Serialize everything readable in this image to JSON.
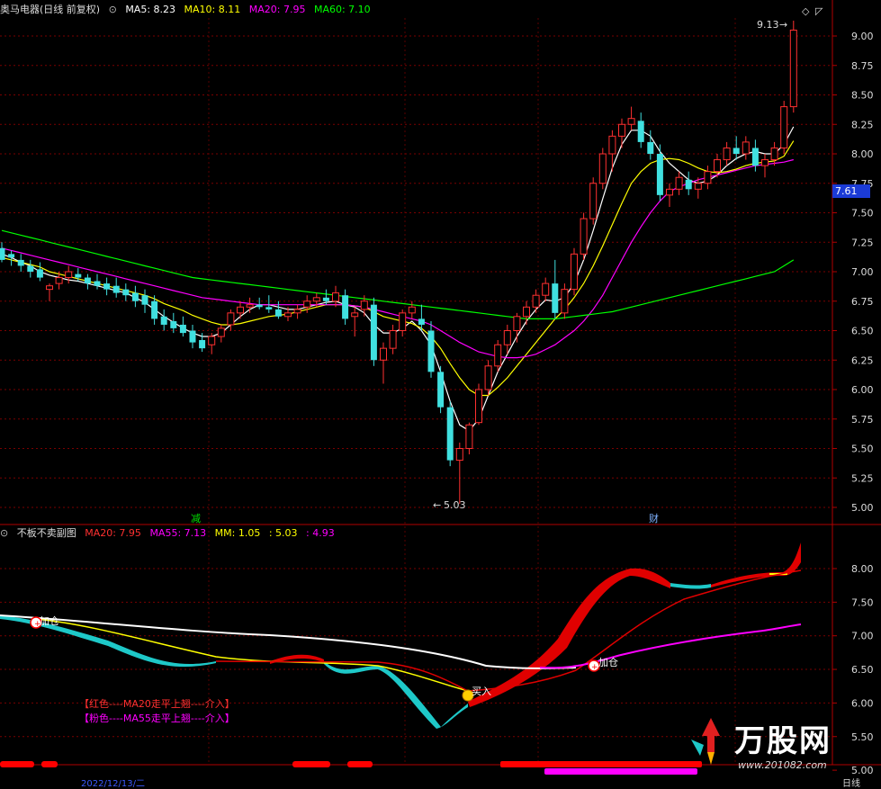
{
  "header_main": {
    "title": "奥马电器(日线 前复权)",
    "ma5": "MA5: 8.23",
    "ma10": "MA10: 8.11",
    "ma20": "MA20: 7.95",
    "ma60": "MA60: 7.10",
    "colors": {
      "title": "#dcdcdc",
      "ma5": "#ffffff",
      "ma10": "#ffff00",
      "ma20": "#ff00ff",
      "ma60": "#00ff00"
    }
  },
  "header_sub": {
    "title": "不板不卖副图",
    "ma20": "MA20: 7.95",
    "ma55": "MA55: 7.13",
    "mm": "MM: 1.05",
    "v1": ": 5.03",
    "v2": ": 4.93"
  },
  "main_axis": {
    "ticks": [
      "9.00",
      "8.75",
      "8.50",
      "8.25",
      "8.00",
      "7.75",
      "7.50",
      "7.25",
      "7.00",
      "6.75",
      "6.50",
      "6.25",
      "6.00",
      "5.75",
      "5.50",
      "5.25",
      "5.00"
    ],
    "current_price": "7.61",
    "high_label": "9.13",
    "low_label": "5.03"
  },
  "sub_axis": {
    "ticks": [
      "8.00",
      "7.50",
      "7.00",
      "6.50",
      "6.00",
      "5.50",
      "5.00"
    ]
  },
  "markers": {
    "reduce": "减",
    "finance": "财",
    "add_left": "加仓",
    "add_right": "加仓",
    "buy": "买入"
  },
  "notes": {
    "line1": "【红色----MA20走平上翘----介入】",
    "line2": "【粉色----MA55走平上翘----介入】"
  },
  "bottom": {
    "date": "2022/12/13/二",
    "right": "日线"
  },
  "brand": {
    "name": "万股网",
    "site": "www.201082.com"
  },
  "icons": {
    "collapse": "circle-chevron-icon",
    "diamond": "diamond-icon"
  },
  "chart_data": {
    "type": "candlestick",
    "title": "奥马电器(日线 前复权)",
    "ylim": [
      4.9,
      9.25
    ],
    "ohlc": [
      [
        7.2,
        7.25,
        7.08,
        7.1
      ],
      [
        7.15,
        7.18,
        7.05,
        7.12
      ],
      [
        7.1,
        7.15,
        7.0,
        7.05
      ],
      [
        7.05,
        7.1,
        6.95,
        7.0
      ],
      [
        7.02,
        7.08,
        6.92,
        6.95
      ],
      [
        6.85,
        6.9,
        6.75,
        6.88
      ],
      [
        6.9,
        7.0,
        6.85,
        6.95
      ],
      [
        6.95,
        7.05,
        6.9,
        7.0
      ],
      [
        6.98,
        7.03,
        6.92,
        6.95
      ],
      [
        6.95,
        6.98,
        6.85,
        6.9
      ],
      [
        6.92,
        6.98,
        6.85,
        6.88
      ],
      [
        6.9,
        6.95,
        6.8,
        6.85
      ],
      [
        6.88,
        6.95,
        6.78,
        6.82
      ],
      [
        6.85,
        6.9,
        6.75,
        6.8
      ],
      [
        6.82,
        6.88,
        6.7,
        6.75
      ],
      [
        6.8,
        6.85,
        6.65,
        6.72
      ],
      [
        6.75,
        6.8,
        6.55,
        6.6
      ],
      [
        6.62,
        6.68,
        6.5,
        6.55
      ],
      [
        6.58,
        6.65,
        6.48,
        6.52
      ],
      [
        6.55,
        6.62,
        6.45,
        6.48
      ],
      [
        6.5,
        6.55,
        6.35,
        6.4
      ],
      [
        6.42,
        6.48,
        6.32,
        6.35
      ],
      [
        6.38,
        6.48,
        6.3,
        6.45
      ],
      [
        6.45,
        6.55,
        6.4,
        6.52
      ],
      [
        6.55,
        6.68,
        6.5,
        6.65
      ],
      [
        6.65,
        6.75,
        6.6,
        6.7
      ],
      [
        6.7,
        6.78,
        6.65,
        6.72
      ],
      [
        6.72,
        6.78,
        6.68,
        6.7
      ],
      [
        6.7,
        6.8,
        6.65,
        6.68
      ],
      [
        6.68,
        6.75,
        6.6,
        6.62
      ],
      [
        6.62,
        6.7,
        6.58,
        6.65
      ],
      [
        6.65,
        6.72,
        6.6,
        6.68
      ],
      [
        6.7,
        6.8,
        6.65,
        6.75
      ],
      [
        6.75,
        6.82,
        6.7,
        6.78
      ],
      [
        6.78,
        6.85,
        6.72,
        6.75
      ],
      [
        6.75,
        6.88,
        6.7,
        6.82
      ],
      [
        6.8,
        6.85,
        6.55,
        6.6
      ],
      [
        6.62,
        6.7,
        6.45,
        6.65
      ],
      [
        6.68,
        6.8,
        6.62,
        6.75
      ],
      [
        6.72,
        6.78,
        6.2,
        6.25
      ],
      [
        6.25,
        6.4,
        6.05,
        6.35
      ],
      [
        6.35,
        6.55,
        6.3,
        6.5
      ],
      [
        6.5,
        6.68,
        6.45,
        6.65
      ],
      [
        6.65,
        6.75,
        6.6,
        6.7
      ],
      [
        6.6,
        6.72,
        6.5,
        6.55
      ],
      [
        6.5,
        6.58,
        6.1,
        6.15
      ],
      [
        6.15,
        6.2,
        5.8,
        5.85
      ],
      [
        5.85,
        5.9,
        5.35,
        5.4
      ],
      [
        5.4,
        5.55,
        5.03,
        5.5
      ],
      [
        5.5,
        5.72,
        5.45,
        5.7
      ],
      [
        5.72,
        6.05,
        5.7,
        6.0
      ],
      [
        6.0,
        6.25,
        5.95,
        6.2
      ],
      [
        6.2,
        6.42,
        6.15,
        6.38
      ],
      [
        6.38,
        6.55,
        6.3,
        6.5
      ],
      [
        6.5,
        6.65,
        6.4,
        6.62
      ],
      [
        6.62,
        6.75,
        6.55,
        6.7
      ],
      [
        6.7,
        6.85,
        6.65,
        6.8
      ],
      [
        6.8,
        6.95,
        6.75,
        6.9
      ],
      [
        6.9,
        7.1,
        6.6,
        6.65
      ],
      [
        6.65,
        6.9,
        6.6,
        6.85
      ],
      [
        6.85,
        7.2,
        6.8,
        7.15
      ],
      [
        7.15,
        7.5,
        7.1,
        7.45
      ],
      [
        7.45,
        7.8,
        7.4,
        7.75
      ],
      [
        7.75,
        8.05,
        7.7,
        8.0
      ],
      [
        8.0,
        8.2,
        7.85,
        8.15
      ],
      [
        8.15,
        8.3,
        8.05,
        8.25
      ],
      [
        8.25,
        8.4,
        8.2,
        8.3
      ],
      [
        8.28,
        8.35,
        8.05,
        8.1
      ],
      [
        8.1,
        8.2,
        7.95,
        8.0
      ],
      [
        8.0,
        8.08,
        7.6,
        7.65
      ],
      [
        7.65,
        7.75,
        7.55,
        7.7
      ],
      [
        7.7,
        7.85,
        7.65,
        7.8
      ],
      [
        7.78,
        7.85,
        7.65,
        7.7
      ],
      [
        7.7,
        7.8,
        7.62,
        7.75
      ],
      [
        7.75,
        7.9,
        7.7,
        7.85
      ],
      [
        7.85,
        8.0,
        7.8,
        7.95
      ],
      [
        7.95,
        8.1,
        7.9,
        8.05
      ],
      [
        8.05,
        8.15,
        7.95,
        8.0
      ],
      [
        8.0,
        8.15,
        7.95,
        8.1
      ],
      [
        8.05,
        8.12,
        7.85,
        7.9
      ],
      [
        7.9,
        8.0,
        7.8,
        7.95
      ],
      [
        7.95,
        8.1,
        7.9,
        8.05
      ],
      [
        8.05,
        8.45,
        8.0,
        8.4
      ],
      [
        8.4,
        9.13,
        8.35,
        9.05
      ]
    ],
    "series": [
      {
        "name": "MA5",
        "color": "#ffffff",
        "values": [
          7.15,
          7.12,
          7.08,
          7.05,
          7.0,
          6.97,
          6.95,
          6.93,
          6.92,
          6.9,
          6.88,
          6.86,
          6.84,
          6.82,
          6.78,
          6.74,
          6.68,
          6.62,
          6.57,
          6.52,
          6.48,
          6.45,
          6.45,
          6.48,
          6.55,
          6.62,
          6.68,
          6.72,
          6.72,
          6.7,
          6.68,
          6.68,
          6.7,
          6.72,
          6.74,
          6.75,
          6.72,
          6.7,
          6.65,
          6.55,
          6.48,
          6.48,
          6.52,
          6.58,
          6.5,
          6.38,
          6.15,
          5.9,
          5.7,
          5.65,
          5.75,
          5.95,
          6.15,
          6.3,
          6.45,
          6.58,
          6.68,
          6.76,
          6.75,
          6.78,
          6.9,
          7.1,
          7.35,
          7.62,
          7.88,
          8.08,
          8.2,
          8.2,
          8.15,
          8.02,
          7.92,
          7.85,
          7.78,
          7.75,
          7.77,
          7.82,
          7.9,
          7.96,
          8.0,
          8.02,
          8.0,
          8.0,
          8.08,
          8.23
        ]
      },
      {
        "name": "MA10",
        "color": "#ffff00",
        "values": [
          7.12,
          7.1,
          7.08,
          7.06,
          7.04,
          7.0,
          6.98,
          6.96,
          6.94,
          6.92,
          6.9,
          6.88,
          6.86,
          6.84,
          6.82,
          6.8,
          6.77,
          6.73,
          6.7,
          6.67,
          6.63,
          6.6,
          6.57,
          6.55,
          6.55,
          6.56,
          6.58,
          6.6,
          6.62,
          6.63,
          6.64,
          6.66,
          6.68,
          6.7,
          6.72,
          6.72,
          6.72,
          6.71,
          6.7,
          6.66,
          6.62,
          6.6,
          6.58,
          6.56,
          6.52,
          6.45,
          6.35,
          6.22,
          6.1,
          6.0,
          5.95,
          5.95,
          6.02,
          6.1,
          6.2,
          6.3,
          6.4,
          6.5,
          6.6,
          6.68,
          6.78,
          6.9,
          7.05,
          7.22,
          7.4,
          7.58,
          7.75,
          7.85,
          7.92,
          7.95,
          7.96,
          7.95,
          7.92,
          7.88,
          7.85,
          7.84,
          7.85,
          7.87,
          7.9,
          7.92,
          7.93,
          7.94,
          7.98,
          8.11
        ]
      },
      {
        "name": "MA20",
        "color": "#ff00ff",
        "values": [
          7.2,
          7.18,
          7.16,
          7.14,
          7.12,
          7.1,
          7.08,
          7.06,
          7.04,
          7.02,
          7.0,
          6.98,
          6.96,
          6.94,
          6.92,
          6.9,
          6.88,
          6.86,
          6.84,
          6.82,
          6.8,
          6.78,
          6.77,
          6.76,
          6.75,
          6.74,
          6.73,
          6.72,
          6.72,
          6.72,
          6.72,
          6.72,
          6.72,
          6.72,
          6.72,
          6.72,
          6.72,
          6.71,
          6.7,
          6.68,
          6.66,
          6.64,
          6.62,
          6.6,
          6.58,
          6.55,
          6.5,
          6.45,
          6.4,
          6.36,
          6.32,
          6.3,
          6.28,
          6.27,
          6.27,
          6.28,
          6.3,
          6.34,
          6.38,
          6.44,
          6.5,
          6.58,
          6.68,
          6.8,
          6.95,
          7.1,
          7.25,
          7.38,
          7.5,
          7.6,
          7.68,
          7.72,
          7.75,
          7.78,
          7.8,
          7.82,
          7.84,
          7.86,
          7.88,
          7.9,
          7.91,
          7.92,
          7.93,
          7.95
        ]
      },
      {
        "name": "MA60",
        "color": "#00ff00",
        "values": [
          7.35,
          7.33,
          7.31,
          7.29,
          7.27,
          7.25,
          7.23,
          7.21,
          7.19,
          7.17,
          7.15,
          7.13,
          7.11,
          7.09,
          7.07,
          7.05,
          7.03,
          7.01,
          6.99,
          6.97,
          6.95,
          6.94,
          6.93,
          6.92,
          6.91,
          6.9,
          6.89,
          6.88,
          6.87,
          6.86,
          6.85,
          6.84,
          6.83,
          6.82,
          6.81,
          6.8,
          6.79,
          6.78,
          6.77,
          6.76,
          6.75,
          6.74,
          6.73,
          6.72,
          6.71,
          6.7,
          6.69,
          6.68,
          6.67,
          6.66,
          6.65,
          6.64,
          6.63,
          6.62,
          6.61,
          6.6,
          6.6,
          6.6,
          6.6,
          6.61,
          6.62,
          6.63,
          6.64,
          6.65,
          6.66,
          6.68,
          6.7,
          6.72,
          6.74,
          6.76,
          6.78,
          6.8,
          6.82,
          6.84,
          6.86,
          6.88,
          6.9,
          6.92,
          6.94,
          6.96,
          6.98,
          7.0,
          7.05,
          7.1
        ]
      }
    ]
  }
}
